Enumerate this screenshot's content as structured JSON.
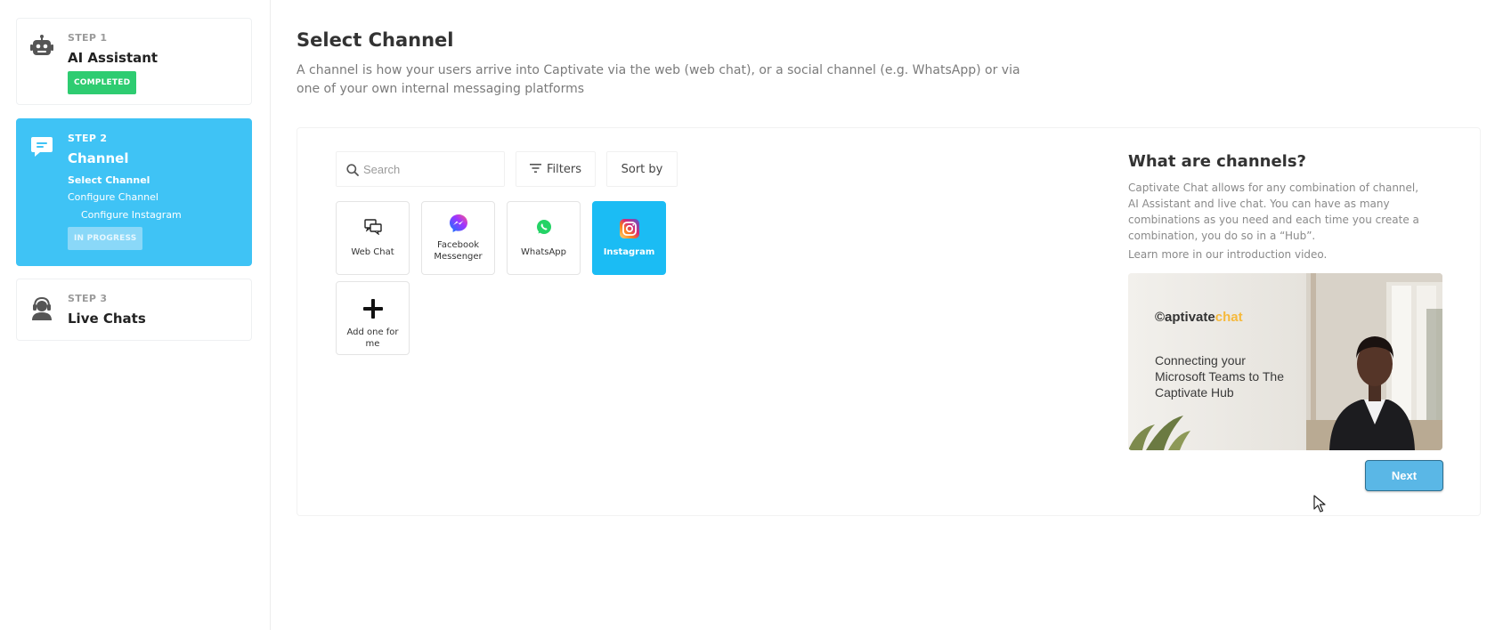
{
  "steps": [
    {
      "number": "STEP 1",
      "title": "AI Assistant",
      "status": "COMPLETED",
      "icon": "robot-icon"
    },
    {
      "number": "STEP 2",
      "title": "Channel",
      "status": "IN PROGRESS",
      "icon": "chat-bubble-icon",
      "substeps": [
        "Select Channel",
        "Configure Channel",
        "Configure Instagram"
      ]
    },
    {
      "number": "STEP 3",
      "title": "Live Chats",
      "icon": "headset-agent-icon"
    }
  ],
  "main": {
    "title": "Select Channel",
    "description": "A channel is how your users arrive into Captivate via the web (web chat), or a social channel (e.g. WhatsApp) or via one of your own internal messaging platforms"
  },
  "toolbar": {
    "search_placeholder": "Search",
    "filters_label": "Filters",
    "sort_label": "Sort by"
  },
  "channels": [
    {
      "label": "Web Chat",
      "icon": "web-chat-icon",
      "selected": false
    },
    {
      "label": "Facebook Messenger",
      "icon": "messenger-icon",
      "selected": false
    },
    {
      "label": "WhatsApp",
      "icon": "whatsapp-icon",
      "selected": false
    },
    {
      "label": "Instagram",
      "icon": "instagram-icon",
      "selected": true
    },
    {
      "label": "Add one for me",
      "icon": "plus-icon",
      "selected": false
    }
  ],
  "info": {
    "title": "What are channels?",
    "text": "Captivate Chat allows for any combination of channel, AI Assistant and live chat. You can have as many combinations as you need and each time you create a combination, you do so in a “Hub”.",
    "link": "Learn more in our introduction video."
  },
  "video": {
    "logo_main": "©aptivate",
    "logo_accent": "chat",
    "caption": "Connecting your Microsoft Teams to The Captivate Hub"
  },
  "actions": {
    "next_label": "Next"
  },
  "colors": {
    "accent": "#3fc3f5",
    "completed": "#2ecc71",
    "selected_tile": "#1bbcf4",
    "next_button": "#5ab7e6"
  }
}
